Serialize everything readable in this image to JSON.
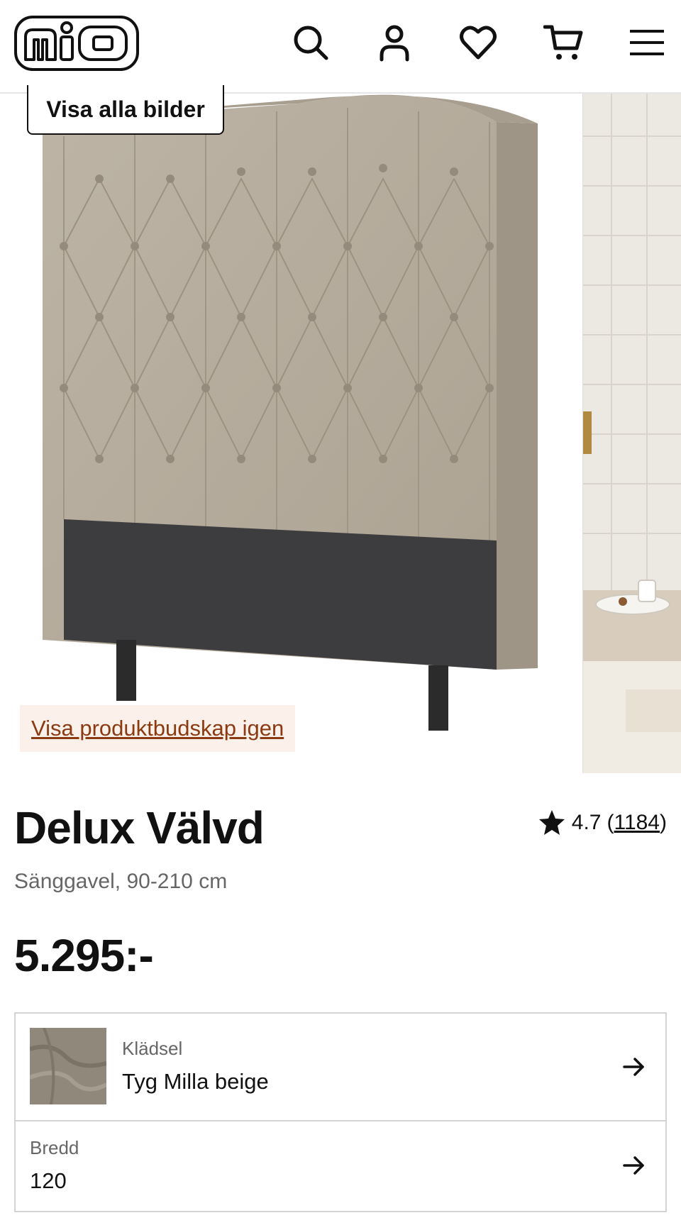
{
  "header": {
    "logo_text": "mio",
    "icons": [
      "search-icon",
      "user-icon",
      "heart-icon",
      "cart-icon",
      "menu-icon"
    ]
  },
  "gallery": {
    "show_all_images_label": "Visa alla bilder",
    "show_product_message_label": "Visa produktbudskap igen"
  },
  "product": {
    "name": "Delux Välvd",
    "subtitle": "Sänggavel, 90-210 cm",
    "price": "5.295:-",
    "rating": {
      "score": "4.7",
      "open_paren": "(",
      "count": "1184",
      "close_paren": ")"
    }
  },
  "options": {
    "upholstery": {
      "label": "Klädsel",
      "value": "Tyg Milla beige"
    },
    "width": {
      "label": "Bredd",
      "value": "120"
    }
  },
  "colors": {
    "link_brown": "#8b3a12",
    "banner_bg": "#fbf1ea",
    "fabric_beige": "#b7ae9f",
    "panel_grey": "#3d3d3f"
  }
}
